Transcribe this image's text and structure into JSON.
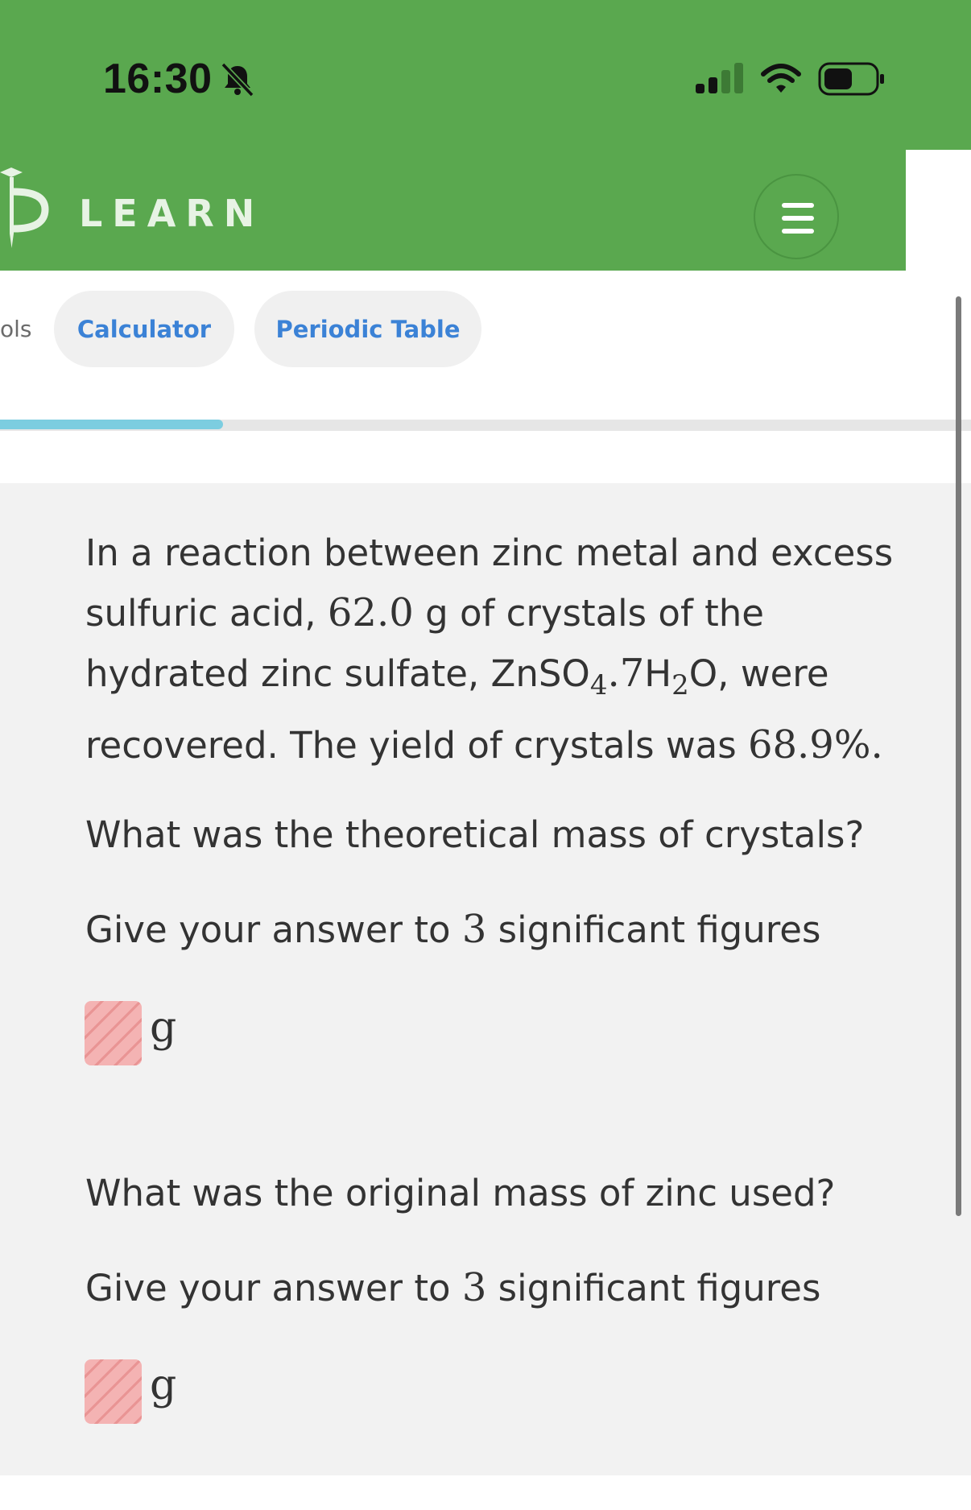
{
  "status_bar": {
    "time": "16:30",
    "icons": [
      "bell-muted-icon",
      "signal-icon",
      "wifi-icon",
      "battery-icon"
    ],
    "background": "#5aa84f"
  },
  "header": {
    "logo_text": "LEARN",
    "menu_icon": "hamburger-icon",
    "brand_color": "#5aa84f"
  },
  "tools": {
    "partial_label": "ols",
    "buttons": [
      "Calculator",
      "Periodic Table"
    ],
    "link_color": "#3b82d6"
  },
  "progress": {
    "fraction": 0.23,
    "fill_color": "#7ccde0"
  },
  "question": {
    "intro_a": "In a reaction between zinc metal and excess sulfuric acid,",
    "mass": "62.0",
    "intro_b": "g of crystals of the hydrated zinc sulfate, ZnSO",
    "sub_4": "4",
    "dot_7": ".7",
    "h": "H",
    "sub_2": "2",
    "o": "O,",
    "intro_c": "were recovered. The yield of crystals was",
    "yield": "68.9%.",
    "parts": [
      {
        "prompt": "What was the theoretical mass of crystals?",
        "instruction_a": "Give your answer to",
        "sig_figs": "3",
        "instruction_b": "significant figures",
        "unit": "g"
      },
      {
        "prompt": "What was the original mass of zinc used?",
        "instruction_a": "Give your answer to",
        "sig_figs": "3",
        "instruction_b": "significant figures",
        "unit": "g"
      }
    ]
  }
}
